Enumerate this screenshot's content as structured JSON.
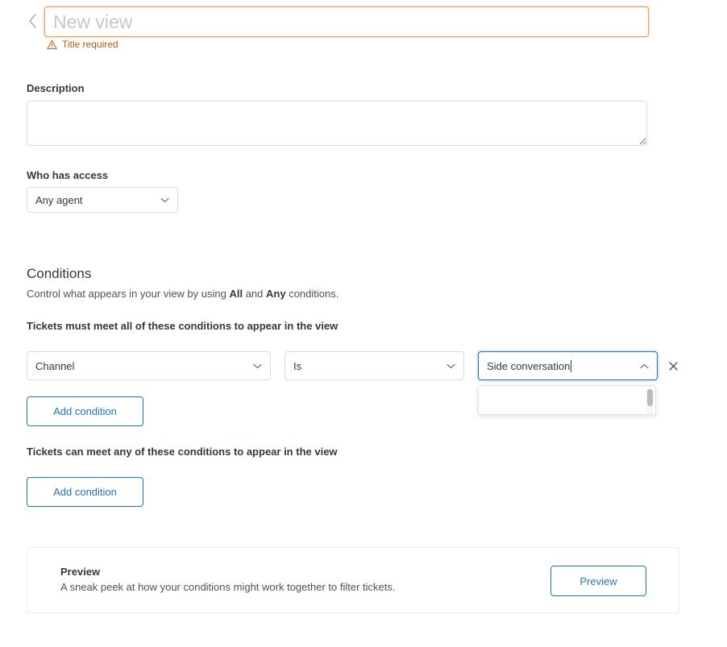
{
  "header": {
    "back_icon": "chevron-left-icon",
    "title_value": "",
    "title_placeholder": "New view",
    "error_icon": "warning-triangle-icon",
    "error_text": "Title required"
  },
  "description": {
    "label": "Description",
    "value": "",
    "placeholder": ""
  },
  "access": {
    "label": "Who has access",
    "selected": "Any agent",
    "chevron_icon": "chevron-down-icon"
  },
  "conditions": {
    "heading": "Conditions",
    "subtitle_prefix": "Control what appears in your view by using ",
    "subtitle_all": "All",
    "subtitle_mid": " and ",
    "subtitle_any": "Any",
    "subtitle_suffix": " conditions.",
    "all_heading": "Tickets must meet all of these conditions to appear in the view",
    "any_heading": "Tickets can meet any of these conditions to appear in the view",
    "row": {
      "attribute": "Channel",
      "attribute_chevron": "chevron-down-icon",
      "operator": "Is",
      "operator_chevron": "chevron-down-icon",
      "value": "Side conversation",
      "value_chevron": "chevron-up-icon",
      "remove_icon": "close-icon"
    },
    "dropdown": {
      "open": true,
      "options": [],
      "scrollbar": "vertical-scrollbar"
    },
    "add_condition_all_label": "Add condition",
    "add_condition_any_label": "Add condition"
  },
  "preview": {
    "title": "Preview",
    "description": "A sneak peek at how your conditions might work together to filter tickets.",
    "button_label": "Preview"
  },
  "colors": {
    "error_border": "#ed9b4e",
    "error_text": "#ad5e18",
    "accent_blue": "#1f73b7",
    "text_primary": "#2f3941",
    "text_secondary": "#49545c",
    "border_light": "#d8dcde"
  }
}
